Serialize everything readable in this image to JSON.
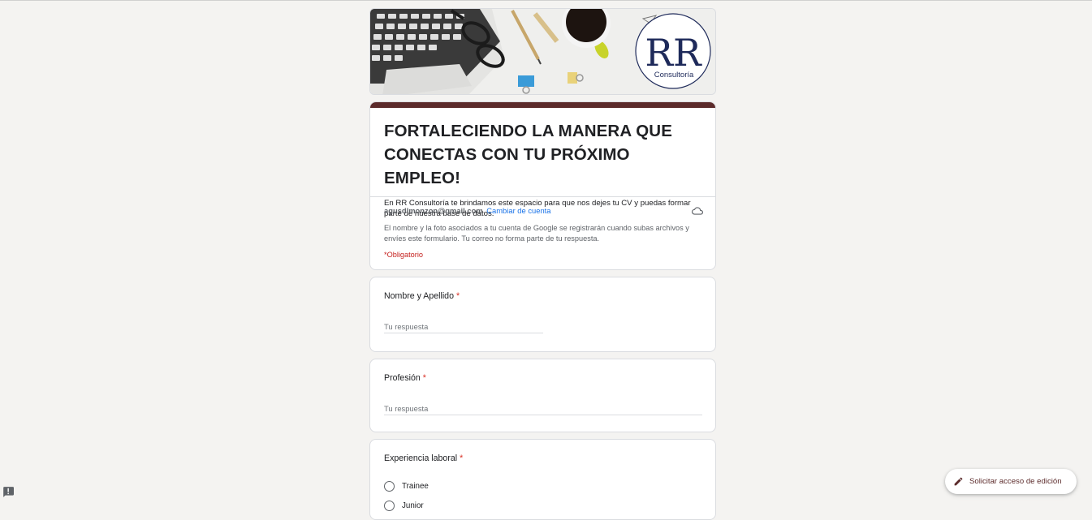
{
  "banner": {
    "logo_mark": "RR",
    "logo_name": "Consultoría"
  },
  "form": {
    "title": "FORTALECIENDO LA MANERA QUE CONECTAS CON TU PRÓXIMO EMPLEO!",
    "description": "En RR Consultoría te brindamos este espacio para que nos dejes tu CV y puedas formar parte de nuestra base de datos.",
    "accent_color": "#5b2a2a"
  },
  "account": {
    "email": "agusdlmonzon@gmail.com",
    "switch_label": "Cambiar de cuenta",
    "notice": "El nombre y la foto asociados a tu cuenta de Google se registrarán cuando subas archivos y envíes este formulario. Tu correo no forma parte de tu respuesta.",
    "required_note": "*Obligatorio",
    "cloud_icon": "cloud-icon"
  },
  "questions": [
    {
      "label": "Nombre y Apellido",
      "required_mark": "*",
      "placeholder": "Tu respuesta"
    },
    {
      "label": "Profesión",
      "required_mark": "*",
      "placeholder": "Tu respuesta"
    },
    {
      "label": "Experiencia laboral",
      "required_mark": "*",
      "options": [
        "Trainee",
        "Junior"
      ]
    }
  ],
  "edit_access": {
    "label": "Solicitar acceso de edición",
    "icon": "pencil-icon"
  },
  "report_icon": "report-icon"
}
